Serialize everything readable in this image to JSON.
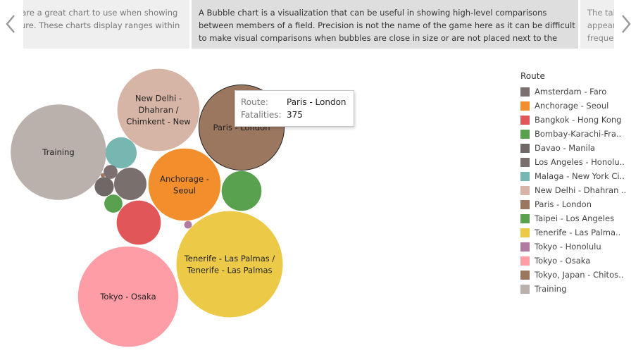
{
  "carousel": {
    "prev_card_lines": [
      ", are a great chart to use when showing",
      "sure. These charts display ranges within"
    ],
    "current_card_lines": [
      "A Bubble chart is a visualization that can be useful in showing high-level comparisons",
      "between members of a field. Precision is not the name of the game here as it can be difficult",
      "to make visual comparisons when bubbles are close in size or are not placed next to the"
    ],
    "next_card_lines": [
      "The tal",
      "appear",
      "freque"
    ]
  },
  "tooltip": {
    "route_key": "Route:",
    "route_value": "Paris - London",
    "fatalities_key": "Fatalities:",
    "fatalities_value": "375"
  },
  "legend": {
    "title": "Route",
    "items": [
      {
        "label": "Amsterdam - Faro",
        "color": "#7b6f6f"
      },
      {
        "label": "Anchorage - Seoul",
        "color": "#f28e2b"
      },
      {
        "label": "Bangkok - Hong Kong",
        "color": "#e15759"
      },
      {
        "label": "Bombay-Karachi-Fra..",
        "color": "#59a14f"
      },
      {
        "label": "Davao - Manila",
        "color": "#706866"
      },
      {
        "label": "Los Angeles - Honolu..",
        "color": "#79706e"
      },
      {
        "label": "Malaga - New York Ci..",
        "color": "#76b7b2"
      },
      {
        "label": "New Delhi - Dhahran ..",
        "color": "#d7b5a6"
      },
      {
        "label": "Paris - London",
        "color": "#9c7760"
      },
      {
        "label": "Taipei - Los Angeles",
        "color": "#59a14f"
      },
      {
        "label": "Tenerife - Las Palma..",
        "color": "#edc948"
      },
      {
        "label": "Tokyo - Honolulu",
        "color": "#b07aa1"
      },
      {
        "label": "Tokyo - Osaka",
        "color": "#ff9da7"
      },
      {
        "label": "Tokyo, Japan - Chitos..",
        "color": "#9c7760"
      },
      {
        "label": "Training",
        "color": "#bab0ac"
      }
    ]
  },
  "chart_data": {
    "type": "bubble",
    "size_measure": "Fatalities",
    "color_field": "Route",
    "bubbles": [
      {
        "route": "Tenerife - Las Palmas / Tenerife - Las Palmas",
        "label_lines": [
          "Tenerife - Las Palmas /",
          "Tenerife - Las Palmas"
        ],
        "value": 583,
        "color": "#edc948"
      },
      {
        "route": "Tokyo - Osaka",
        "label_lines": [
          "Tokyo - Osaka"
        ],
        "value": 520,
        "color": "#ff9da7"
      },
      {
        "route": "Training",
        "label_lines": [
          "Training"
        ],
        "value": 470,
        "color": "#bab0ac"
      },
      {
        "route": "Paris - London",
        "label_lines": [
          "Paris - London"
        ],
        "value": 375,
        "color": "#9c7760",
        "highlighted": true
      },
      {
        "route": "New Delhi - Dhahran / Chimkent - New",
        "label_lines": [
          "New Delhi -",
          "Dhahran /",
          "Chimkent - New"
        ],
        "value": 349,
        "color": "#d7b5a6"
      },
      {
        "route": "Anchorage - Seoul",
        "label_lines": [
          "Anchorage -",
          "Seoul"
        ],
        "value": 269,
        "color": "#f28e2b"
      },
      {
        "route": "Bangkok - Hong Kong",
        "label_lines": [],
        "value": 101,
        "color": "#e15759"
      },
      {
        "route": "Taipei - Los Angeles",
        "label_lines": [],
        "value": 82,
        "color": "#59a14f"
      },
      {
        "route": "Los Angeles - Honolulu",
        "label_lines": [],
        "value": 54,
        "color": "#79706e"
      },
      {
        "route": "Malaga - New York City",
        "label_lines": [],
        "value": 50,
        "color": "#76b7b2"
      },
      {
        "route": "Davao - Manila",
        "label_lines": [],
        "value": 19,
        "color": "#706866"
      },
      {
        "route": "Bombay-Karachi-Frankfurt",
        "label_lines": [],
        "value": 17,
        "color": "#59a14f"
      },
      {
        "route": "Amsterdam - Faro",
        "label_lines": [],
        "value": 10,
        "color": "#7b6f6f"
      },
      {
        "route": "Tokyo - Honolulu",
        "label_lines": [],
        "value": 3,
        "color": "#b07aa1"
      },
      {
        "route": "Tokyo, Japan - Chitose",
        "label_lines": [],
        "value": 1,
        "color": "#9c7760"
      }
    ]
  }
}
